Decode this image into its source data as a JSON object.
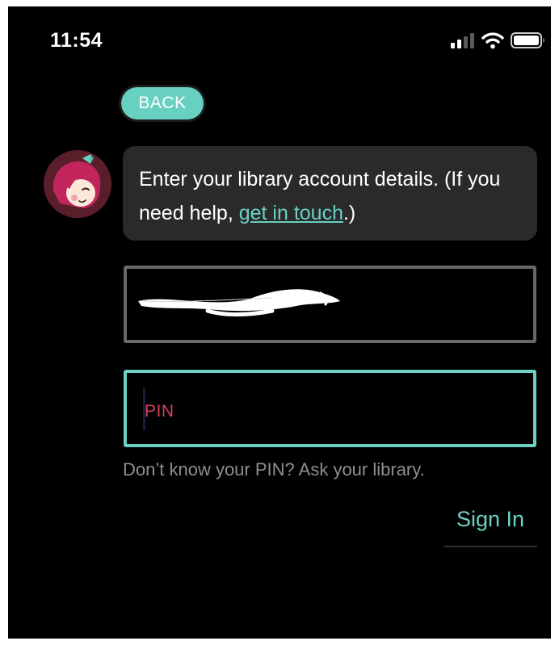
{
  "status_bar": {
    "time": "11:54",
    "icons": [
      "cellular-signal-icon",
      "wifi-icon",
      "battery-icon"
    ]
  },
  "back_button": {
    "label": "BACK"
  },
  "message": {
    "text_before": "Enter your library account details. (If you need help, ",
    "link_text": "get in touch",
    "text_after": ".)"
  },
  "form": {
    "username": {
      "value": "",
      "redacted": true
    },
    "pin": {
      "placeholder": "PIN",
      "value": ""
    },
    "help_text": "Don’t know your PIN? Ask your library.",
    "submit_label": "Sign In"
  },
  "colors": {
    "accent": "#68d0c1",
    "background": "#000000",
    "bubble": "#2a2a2a",
    "placeholder": "#d4455c",
    "muted_text": "#8e8e93"
  }
}
